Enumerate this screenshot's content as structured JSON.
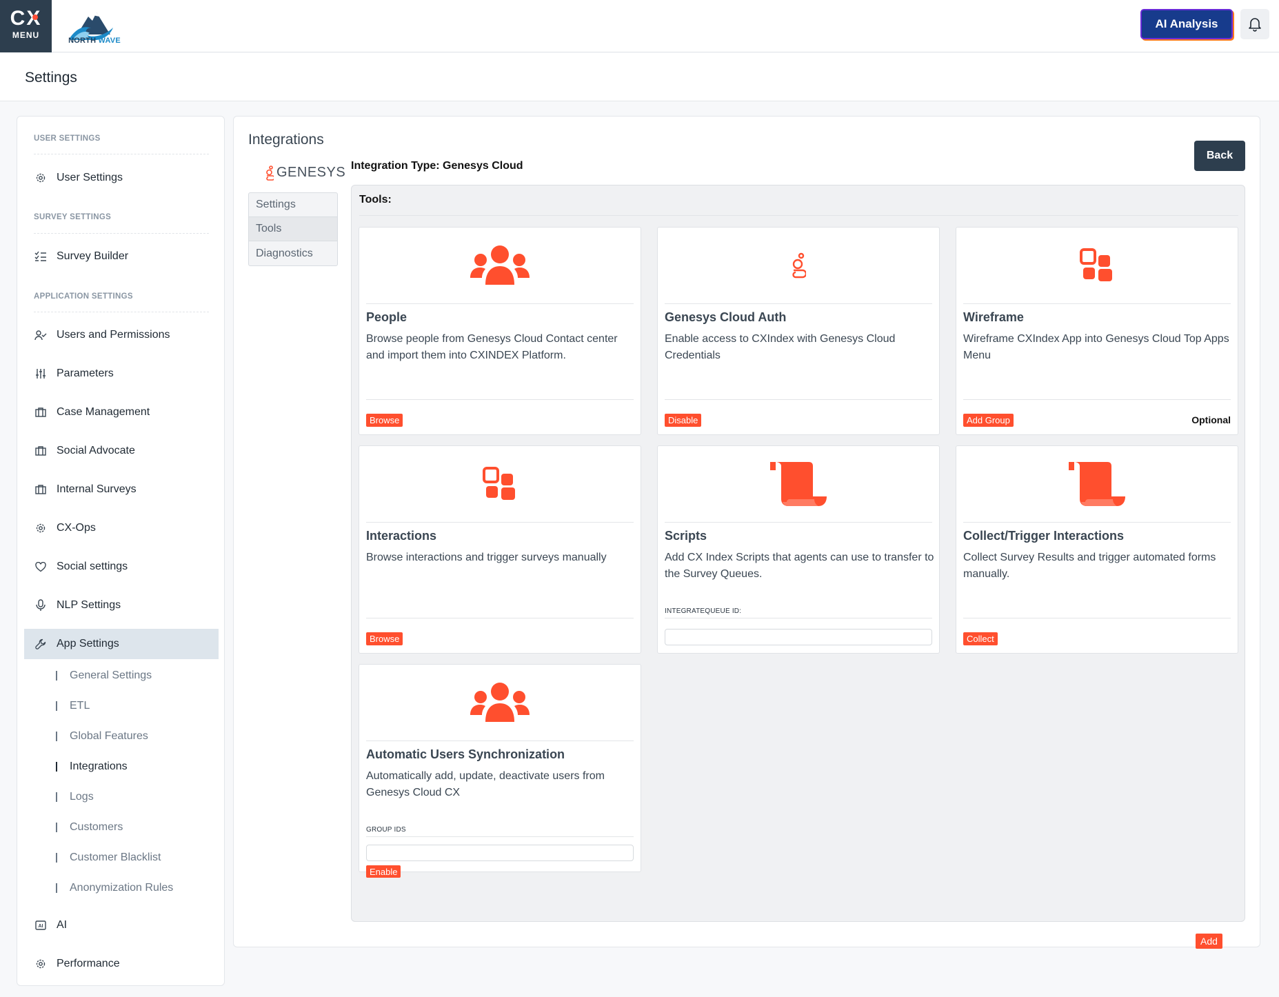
{
  "topbar": {
    "menu_brand": "CX",
    "menu_label": "MENU",
    "logo_text_a": "NORTH",
    "logo_text_b": "WAVE",
    "ai_button": "AI Analysis"
  },
  "page": {
    "title": "Settings"
  },
  "sidebar": {
    "sections": [
      {
        "heading": "USER SETTINGS"
      },
      {
        "heading": "SURVEY SETTINGS"
      },
      {
        "heading": "APPLICATION SETTINGS"
      }
    ],
    "items": [
      {
        "label": "User Settings",
        "icon": "gear-icon"
      },
      {
        "label": "Survey Builder",
        "icon": "checklist-icon"
      },
      {
        "label": "Users and Permissions",
        "icon": "user-check-icon"
      },
      {
        "label": "Parameters",
        "icon": "sliders-icon"
      },
      {
        "label": "Case Management",
        "icon": "briefcase-icon"
      },
      {
        "label": "Social Advocate",
        "icon": "briefcase-icon"
      },
      {
        "label": "Internal Surveys",
        "icon": "briefcase-icon"
      },
      {
        "label": "CX-Ops",
        "icon": "gear-icon"
      },
      {
        "label": "Social settings",
        "icon": "heart-icon"
      },
      {
        "label": "NLP Settings",
        "icon": "microphone-icon"
      },
      {
        "label": "App Settings",
        "icon": "wrench-icon"
      },
      {
        "label": "AI",
        "icon": "ai-chip-icon"
      },
      {
        "label": "Performance",
        "icon": "gear-icon"
      }
    ],
    "sub_items": [
      {
        "label": "General Settings"
      },
      {
        "label": "ETL"
      },
      {
        "label": "Global Features"
      },
      {
        "label": "Integrations"
      },
      {
        "label": "Logs"
      },
      {
        "label": "Customers"
      },
      {
        "label": "Customer Blacklist"
      },
      {
        "label": "Anonymization Rules"
      }
    ]
  },
  "main": {
    "title": "Integrations",
    "genesys_word": "GENESYS",
    "integration_type": "Integration Type: Genesys Cloud",
    "back_button": "Back",
    "tabs": [
      {
        "label": "Settings"
      },
      {
        "label": "Tools"
      },
      {
        "label": "Diagnostics"
      }
    ],
    "tools_label": "Tools:",
    "cards": [
      {
        "title": "People",
        "description": "Browse people from Genesys Cloud Contact center and import them into CXINDEX Platform.",
        "button": "Browse",
        "icon": "people-icon"
      },
      {
        "title": "Genesys Cloud Auth",
        "description": "Enable access to CXIndex with Genesys Cloud Credentials",
        "button": "Disable",
        "icon": "genesys-icon"
      },
      {
        "title": "Wireframe",
        "description": "Wireframe CXIndex App into Genesys Cloud Top Apps Menu",
        "button": "Add Group",
        "optional": "Optional",
        "icon": "apps-icon"
      },
      {
        "title": "Interactions",
        "description": "Browse interactions and trigger surveys manually",
        "button": "Browse",
        "icon": "apps-icon"
      },
      {
        "title": "Scripts",
        "description": "Add CX Index Scripts that agents can use to transfer to the Survey Queues.",
        "field_label": "INTEGRATEQUEUE ID:",
        "field_value": "",
        "icon": "scroll-icon"
      },
      {
        "title": "Collect/Trigger Interactions",
        "description": "Collect Survey Results and trigger automated forms manually.",
        "button": "Collect",
        "icon": "scroll-icon"
      },
      {
        "title": "Automatic Users Synchronization",
        "description": "Automatically add, update, deactivate users from Genesys Cloud CX",
        "field_label": "GROUP IDS",
        "field_value": "",
        "button": "Enable",
        "icon": "people-icon"
      }
    ],
    "add_button": "Add"
  },
  "colors": {
    "accent": "#ff4f2e",
    "dark": "#2d3e4e",
    "ai_button_bg": "#173b8c"
  }
}
